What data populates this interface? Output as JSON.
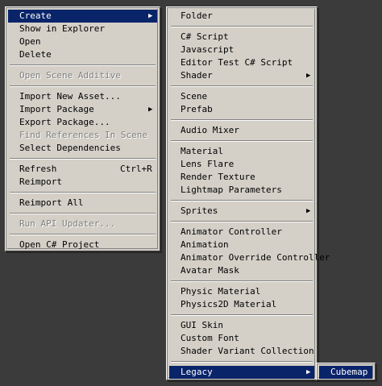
{
  "main_menu": {
    "create": "Create",
    "show_in_explorer": "Show in Explorer",
    "open": "Open",
    "delete": "Delete",
    "open_scene_additive": "Open Scene Additive",
    "import_new_asset": "Import New Asset...",
    "import_package": "Import Package",
    "export_package": "Export Package...",
    "find_references": "Find References In Scene",
    "select_dependencies": "Select Dependencies",
    "refresh": "Refresh",
    "refresh_shortcut": "Ctrl+R",
    "reimport": "Reimport",
    "reimport_all": "Reimport All",
    "run_api_updater": "Run API Updater...",
    "open_csharp_project": "Open C# Project"
  },
  "create_menu": {
    "folder": "Folder",
    "csharp_script": "C# Script",
    "javascript": "Javascript",
    "editor_test_csharp_script": "Editor Test C# Script",
    "shader": "Shader",
    "scene": "Scene",
    "prefab": "Prefab",
    "audio_mixer": "Audio Mixer",
    "material": "Material",
    "lens_flare": "Lens Flare",
    "render_texture": "Render Texture",
    "lightmap_parameters": "Lightmap Parameters",
    "sprites": "Sprites",
    "animator_controller": "Animator Controller",
    "animation": "Animation",
    "animator_override_controller": "Animator Override Controller",
    "avatar_mask": "Avatar Mask",
    "physic_material": "Physic Material",
    "physics2d_material": "Physics2D Material",
    "gui_skin": "GUI Skin",
    "custom_font": "Custom Font",
    "shader_variant_collection": "Shader Variant Collection",
    "legacy": "Legacy"
  },
  "legacy_menu": {
    "cubemap": "Cubemap"
  },
  "icons": {
    "submenu_arrow": "submenu-arrow-icon",
    "submenu_glyph": "▶"
  },
  "colors": {
    "background": "#3b3b3b",
    "menu_face": "#d4d0c8",
    "highlight": "#0a246a",
    "highlight_text": "#ffffff",
    "disabled_text": "#808080"
  }
}
